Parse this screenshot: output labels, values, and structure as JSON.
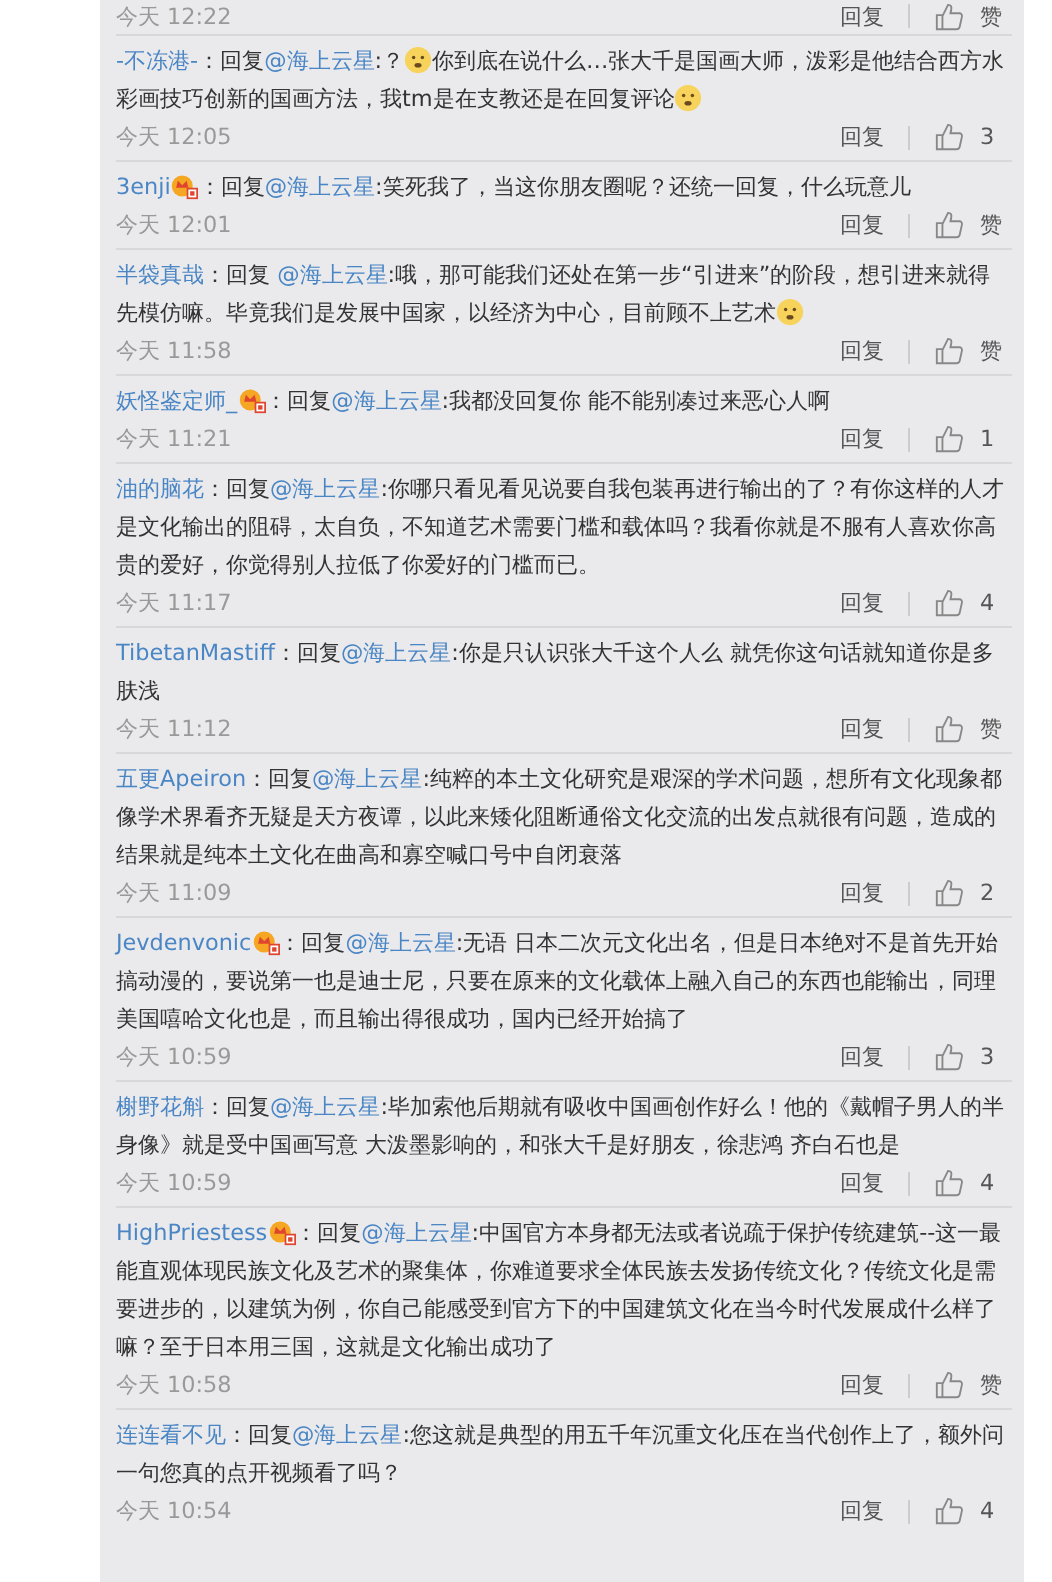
{
  "top_footer": {
    "time": "今天 12:22",
    "reply": "回复",
    "likes": "赞"
  },
  "comments": [
    {
      "author": "-不冻港-",
      "vip": false,
      "reply_label": "：回复",
      "mention": "@海上云星",
      "segments": [
        {
          "kind": "text",
          "value": ":？"
        },
        {
          "kind": "emoji"
        },
        {
          "kind": "text",
          "value": "你到底在说什么…张大千是国画大师，泼彩是他结合西方水彩画技巧创新的国画方法，我tm是在支教还是在回复评论"
        },
        {
          "kind": "emoji"
        }
      ],
      "time": "今天 12:05",
      "reply": "回复",
      "likes": "3"
    },
    {
      "author": "3enji",
      "vip": true,
      "reply_label": "：回复",
      "mention": "@海上云星",
      "segments": [
        {
          "kind": "text",
          "value": ":笑死我了，当这你朋友圈呢？还统一回复，什么玩意儿"
        }
      ],
      "time": "今天 12:01",
      "reply": "回复",
      "likes": "赞"
    },
    {
      "author": "半袋真哉",
      "vip": false,
      "reply_label": "：回复 ",
      "mention": "@海上云星",
      "segments": [
        {
          "kind": "text",
          "value": ":哦，那可能我们还处在第一步“引进来”的阶段，想引进来就得先模仿嘛。毕竟我们是发展中国家，以经济为中心，目前顾不上艺术"
        },
        {
          "kind": "emoji"
        }
      ],
      "time": "今天 11:58",
      "reply": "回复",
      "likes": "赞"
    },
    {
      "author": "妖怪鉴定师_",
      "vip": true,
      "reply_label": "：回复",
      "mention": "@海上云星",
      "segments": [
        {
          "kind": "text",
          "value": ":我都没回复你 能不能别凑过来恶心人啊"
        }
      ],
      "time": "今天 11:21",
      "reply": "回复",
      "likes": "1"
    },
    {
      "author": "油的脑花",
      "vip": false,
      "reply_label": "：回复",
      "mention": "@海上云星",
      "segments": [
        {
          "kind": "text",
          "value": ":你哪只看见看见说要自我包装再进行输出的了？有你这样的人才是文化输出的阻碍，太自负，不知道艺术需要门槛和载体吗？我看你就是不服有人喜欢你高贵的爱好，你觉得别人拉低了你爱好的门槛而已。"
        }
      ],
      "time": "今天 11:17",
      "reply": "回复",
      "likes": "4"
    },
    {
      "author": "TibetanMastiff",
      "vip": false,
      "reply_label": "：回复",
      "mention": "@海上云星",
      "segments": [
        {
          "kind": "text",
          "value": ":你是只认识张大千这个人么 就凭你这句话就知道你是多肤浅"
        }
      ],
      "time": "今天 11:12",
      "reply": "回复",
      "likes": "赞"
    },
    {
      "author": "五更Apeiron",
      "vip": false,
      "reply_label": "：回复",
      "mention": "@海上云星",
      "segments": [
        {
          "kind": "text",
          "value": ":纯粹的本土文化研究是艰深的学术问题，想所有文化现象都像学术界看齐无疑是天方夜谭，以此来矮化阻断通俗文化交流的出发点就很有问题，造成的结果就是纯本土文化在曲高和寡空喊口号中自闭衰落"
        }
      ],
      "time": "今天 11:09",
      "reply": "回复",
      "likes": "2"
    },
    {
      "author": "Jevdenvonic",
      "vip": true,
      "reply_label": "：回复",
      "mention": "@海上云星",
      "segments": [
        {
          "kind": "text",
          "value": ":无语 日本二次元文化出名，但是日本绝对不是首先开始搞动漫的，要说第一也是迪士尼，只要在原来的文化载体上融入自己的东西也能输出，同理美国嘻哈文化也是，而且输出得很成功，国内已经开始搞了"
        }
      ],
      "time": "今天 10:59",
      "reply": "回复",
      "likes": "3"
    },
    {
      "author": "榭野花斛",
      "vip": false,
      "reply_label": "：回复",
      "mention": "@海上云星",
      "segments": [
        {
          "kind": "text",
          "value": ":毕加索他后期就有吸收中国画创作好么！他的《戴帽子男人的半身像》就是受中国画写意 大泼墨影响的，和张大千是好朋友，徐悲鸿 齐白石也是"
        }
      ],
      "time": "今天 10:59",
      "reply": "回复",
      "likes": "4"
    },
    {
      "author": "HighPriestess",
      "vip": true,
      "reply_label": "：回复",
      "mention": "@海上云星",
      "segments": [
        {
          "kind": "text",
          "value": ":中国官方本身都无法或者说疏于保护传统建筑--这一最能直观体现民族文化及艺术的聚集体，你难道要求全体民族去发扬传统文化？传统文化是需要进步的，以建筑为例，你自己能感受到官方下的中国建筑文化在当今时代发展成什么样了嘛？至于日本用三国，这就是文化输出成功了"
        }
      ],
      "time": "今天 10:58",
      "reply": "回复",
      "likes": "赞"
    },
    {
      "author": "连连看不见",
      "vip": false,
      "reply_label": "：回复",
      "mention": "@海上云星",
      "segments": [
        {
          "kind": "text",
          "value": ":您这就是典型的用五千年沉重文化压在当代创作上了，额外问一句您真的点开视频看了吗？"
        }
      ],
      "time": "今天 10:54",
      "reply": "回复",
      "likes": "4"
    }
  ]
}
